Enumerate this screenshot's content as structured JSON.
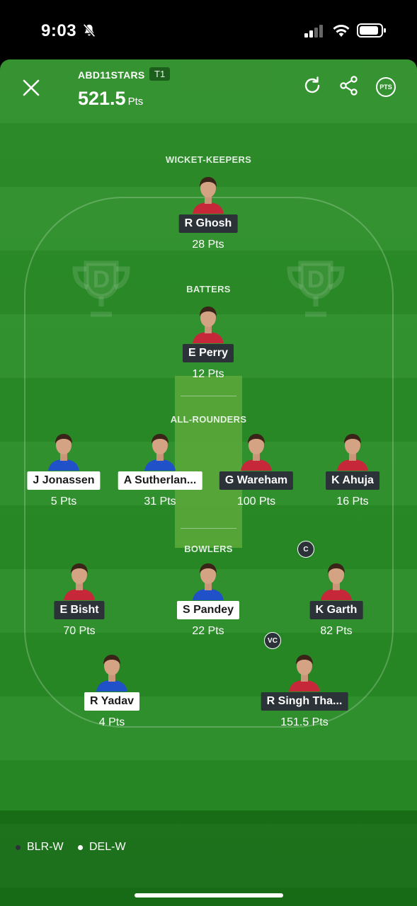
{
  "status_bar": {
    "time": "9:03"
  },
  "header": {
    "team_name": "ABD11STARS",
    "team_tag": "T1",
    "total_points": "521.5",
    "points_unit": "Pts",
    "pts_badge": "PTS"
  },
  "sections": {
    "wicket_keepers": "WICKET-KEEPERS",
    "batters": "BATTERS",
    "all_rounders": "ALL-ROUNDERS",
    "bowlers": "BOWLERS"
  },
  "players": [
    {
      "name": "R Ghosh",
      "points": "28 Pts",
      "team": "BLR-W",
      "badge": "",
      "jersey": "#c6283a"
    },
    {
      "name": "E Perry",
      "points": "12 Pts",
      "team": "BLR-W",
      "badge": "",
      "jersey": "#c6283a"
    },
    {
      "name": "J Jonassen",
      "points": "5 Pts",
      "team": "DEL-W",
      "badge": "",
      "jersey": "#2151c9"
    },
    {
      "name": "A Sutherlan...",
      "points": "31 Pts",
      "team": "DEL-W",
      "badge": "",
      "jersey": "#2151c9"
    },
    {
      "name": "G Wareham",
      "points": "100 Pts",
      "team": "BLR-W",
      "badge": "",
      "jersey": "#c6283a"
    },
    {
      "name": "K Ahuja",
      "points": "16 Pts",
      "team": "BLR-W",
      "badge": "",
      "jersey": "#c6283a"
    },
    {
      "name": "E Bisht",
      "points": "70 Pts",
      "team": "BLR-W",
      "badge": "",
      "jersey": "#c6283a"
    },
    {
      "name": "S Pandey",
      "points": "22 Pts",
      "team": "DEL-W",
      "badge": "",
      "jersey": "#2151c9"
    },
    {
      "name": "K Garth",
      "points": "82 Pts",
      "team": "BLR-W",
      "badge": "C",
      "jersey": "#c6283a"
    },
    {
      "name": "R Yadav",
      "points": "4 Pts",
      "team": "DEL-W",
      "badge": "",
      "jersey": "#2151c9"
    },
    {
      "name": "R Singh Tha...",
      "points": "151.5 Pts",
      "team": "BLR-W",
      "badge": "VC",
      "jersey": "#c6283a"
    }
  ],
  "legend": [
    {
      "label": "BLR-W",
      "color": "#2b3238"
    },
    {
      "label": "DEL-W",
      "color": "#ffffff"
    }
  ]
}
